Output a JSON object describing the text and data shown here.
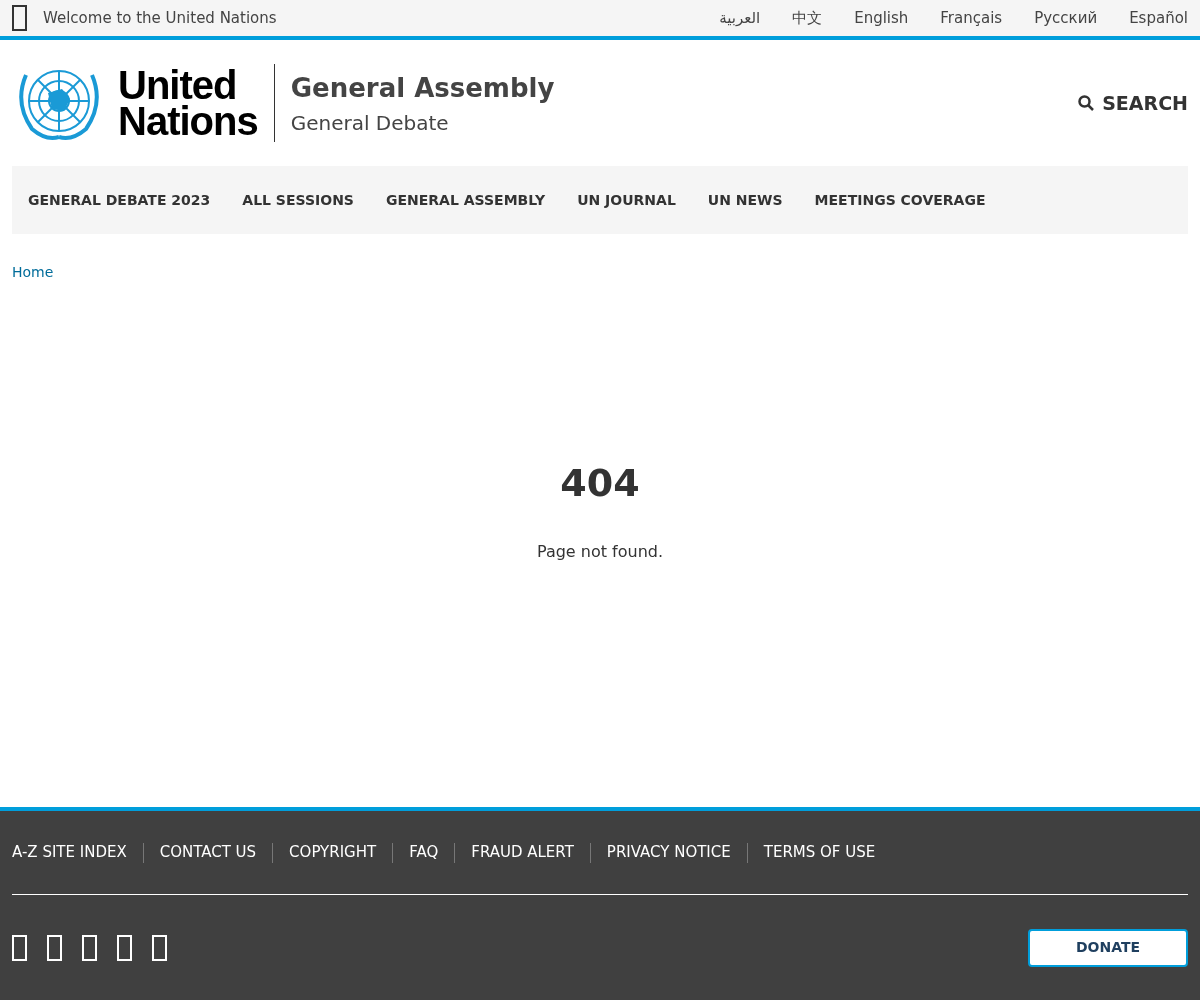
{
  "top_bar": {
    "welcome": "Welcome to the United Nations",
    "languages": [
      {
        "label": "العربية",
        "selected": false
      },
      {
        "label": "中文",
        "selected": false
      },
      {
        "label": "English",
        "selected": false
      },
      {
        "label": "Français",
        "selected": false
      },
      {
        "label": "Русский",
        "selected": false
      },
      {
        "label": "Español",
        "selected": false
      }
    ]
  },
  "header": {
    "logo_line_1": "United",
    "logo_line_2": "Nations",
    "title": "General Assembly",
    "subtitle": "General Debate",
    "search": "SEARCH"
  },
  "nav": [
    "GENERAL DEBATE 2023",
    "ALL SESSIONS",
    "GENERAL ASSEMBLY",
    "UN JOURNAL",
    "UN NEWS",
    "MEETINGS COVERAGE"
  ],
  "breadcrumb": [
    "Home"
  ],
  "error": {
    "code": "404",
    "message": "Page not found."
  },
  "footer": {
    "links": [
      "A-Z SITE INDEX",
      "CONTACT US",
      "COPYRIGHT",
      "FAQ",
      "FRAUD ALERT",
      "PRIVACY NOTICE",
      "TERMS OF USE"
    ],
    "donate": "DONATE"
  }
}
